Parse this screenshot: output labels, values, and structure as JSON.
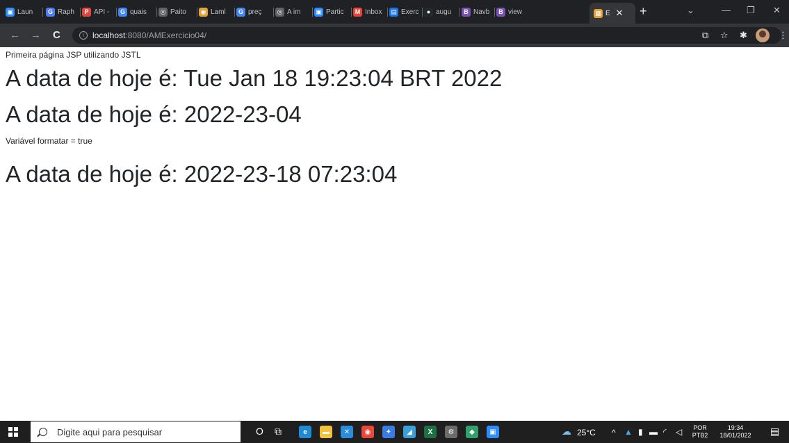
{
  "browser": {
    "tabs": [
      {
        "label": "Laun",
        "color": "#2d8cff",
        "glyph": "▣"
      },
      {
        "label": "Raph",
        "color": "#4e7cf4",
        "glyph": "G"
      },
      {
        "label": "API -",
        "color": "#e0483e",
        "glyph": "P"
      },
      {
        "label": "quais",
        "color": "#4285f4",
        "glyph": "G"
      },
      {
        "label": "Paito",
        "color": "#5f6368",
        "glyph": "◎"
      },
      {
        "label": "Laml",
        "color": "#e2a13a",
        "glyph": "◉"
      },
      {
        "label": "preç",
        "color": "#4285f4",
        "glyph": "G"
      },
      {
        "label": "A im",
        "color": "#5f6368",
        "glyph": "◎"
      },
      {
        "label": "Partic",
        "color": "#2d8cff",
        "glyph": "▣"
      },
      {
        "label": "Inbox",
        "color": "#ea4335",
        "glyph": "M"
      },
      {
        "label": "Exerc",
        "color": "#1a73e8",
        "glyph": "▤"
      },
      {
        "label": "augu",
        "color": "#24292e",
        "glyph": "●"
      },
      {
        "label": "Navb",
        "color": "#7952b3",
        "glyph": "B"
      },
      {
        "label": "view",
        "color": "#7952b3",
        "glyph": "B"
      }
    ],
    "active_tab": {
      "label": "E",
      "close": "✕",
      "color": "#e2a13a",
      "glyph": "▦"
    },
    "new_tab": "+",
    "window_controls": {
      "dropdown": "⌄",
      "minimize": "—",
      "maximize": "❐",
      "close": "✕"
    },
    "toolbar": {
      "back": "←",
      "forward": "→",
      "reload": "C",
      "info": "i",
      "url_host": "localhost",
      "url_rest": ":8080/AMExercicio04/",
      "share": "⧉",
      "star": "☆",
      "extensions": "✱",
      "menu": "⋮"
    }
  },
  "page": {
    "heading_small": "Primeira página JSP utilizando JSTL",
    "date1": "A data de hoje é: Tue Jan 18 19:23:04 BRT 2022",
    "date2": "A data de hoje é: 2022-23-04",
    "var_line": "Variável formatar = true",
    "date3": "A data de hoje é: 2022-23-18 07:23:04"
  },
  "taskbar": {
    "search_placeholder": "Digite aqui para pesquisar",
    "cortana": "O",
    "taskview": "⧉",
    "apps": [
      {
        "name": "edge",
        "color": "#1f8ad6",
        "glyph": "e"
      },
      {
        "name": "explorer",
        "color": "#f3c13a",
        "glyph": "▬"
      },
      {
        "name": "vscode",
        "color": "#2a8cdd",
        "glyph": "✕"
      },
      {
        "name": "chrome",
        "color": "#e8483a",
        "glyph": "◉"
      },
      {
        "name": "app5",
        "color": "#3a7de0",
        "glyph": "✦"
      },
      {
        "name": "app6",
        "color": "#3aa0d8",
        "glyph": "◢"
      },
      {
        "name": "excel",
        "color": "#1d7044",
        "glyph": "X"
      },
      {
        "name": "settings",
        "color": "#6b6b6b",
        "glyph": "⚙"
      },
      {
        "name": "app9",
        "color": "#30a06c",
        "glyph": "◆"
      },
      {
        "name": "zoom",
        "color": "#2d8cff",
        "glyph": "▣"
      }
    ],
    "weather": "25°C",
    "tray_arrow": "^",
    "lang_top": "POR",
    "lang_bottom": "PTB2",
    "time": "19:34",
    "date": "18/01/2022",
    "notification": "▤"
  }
}
